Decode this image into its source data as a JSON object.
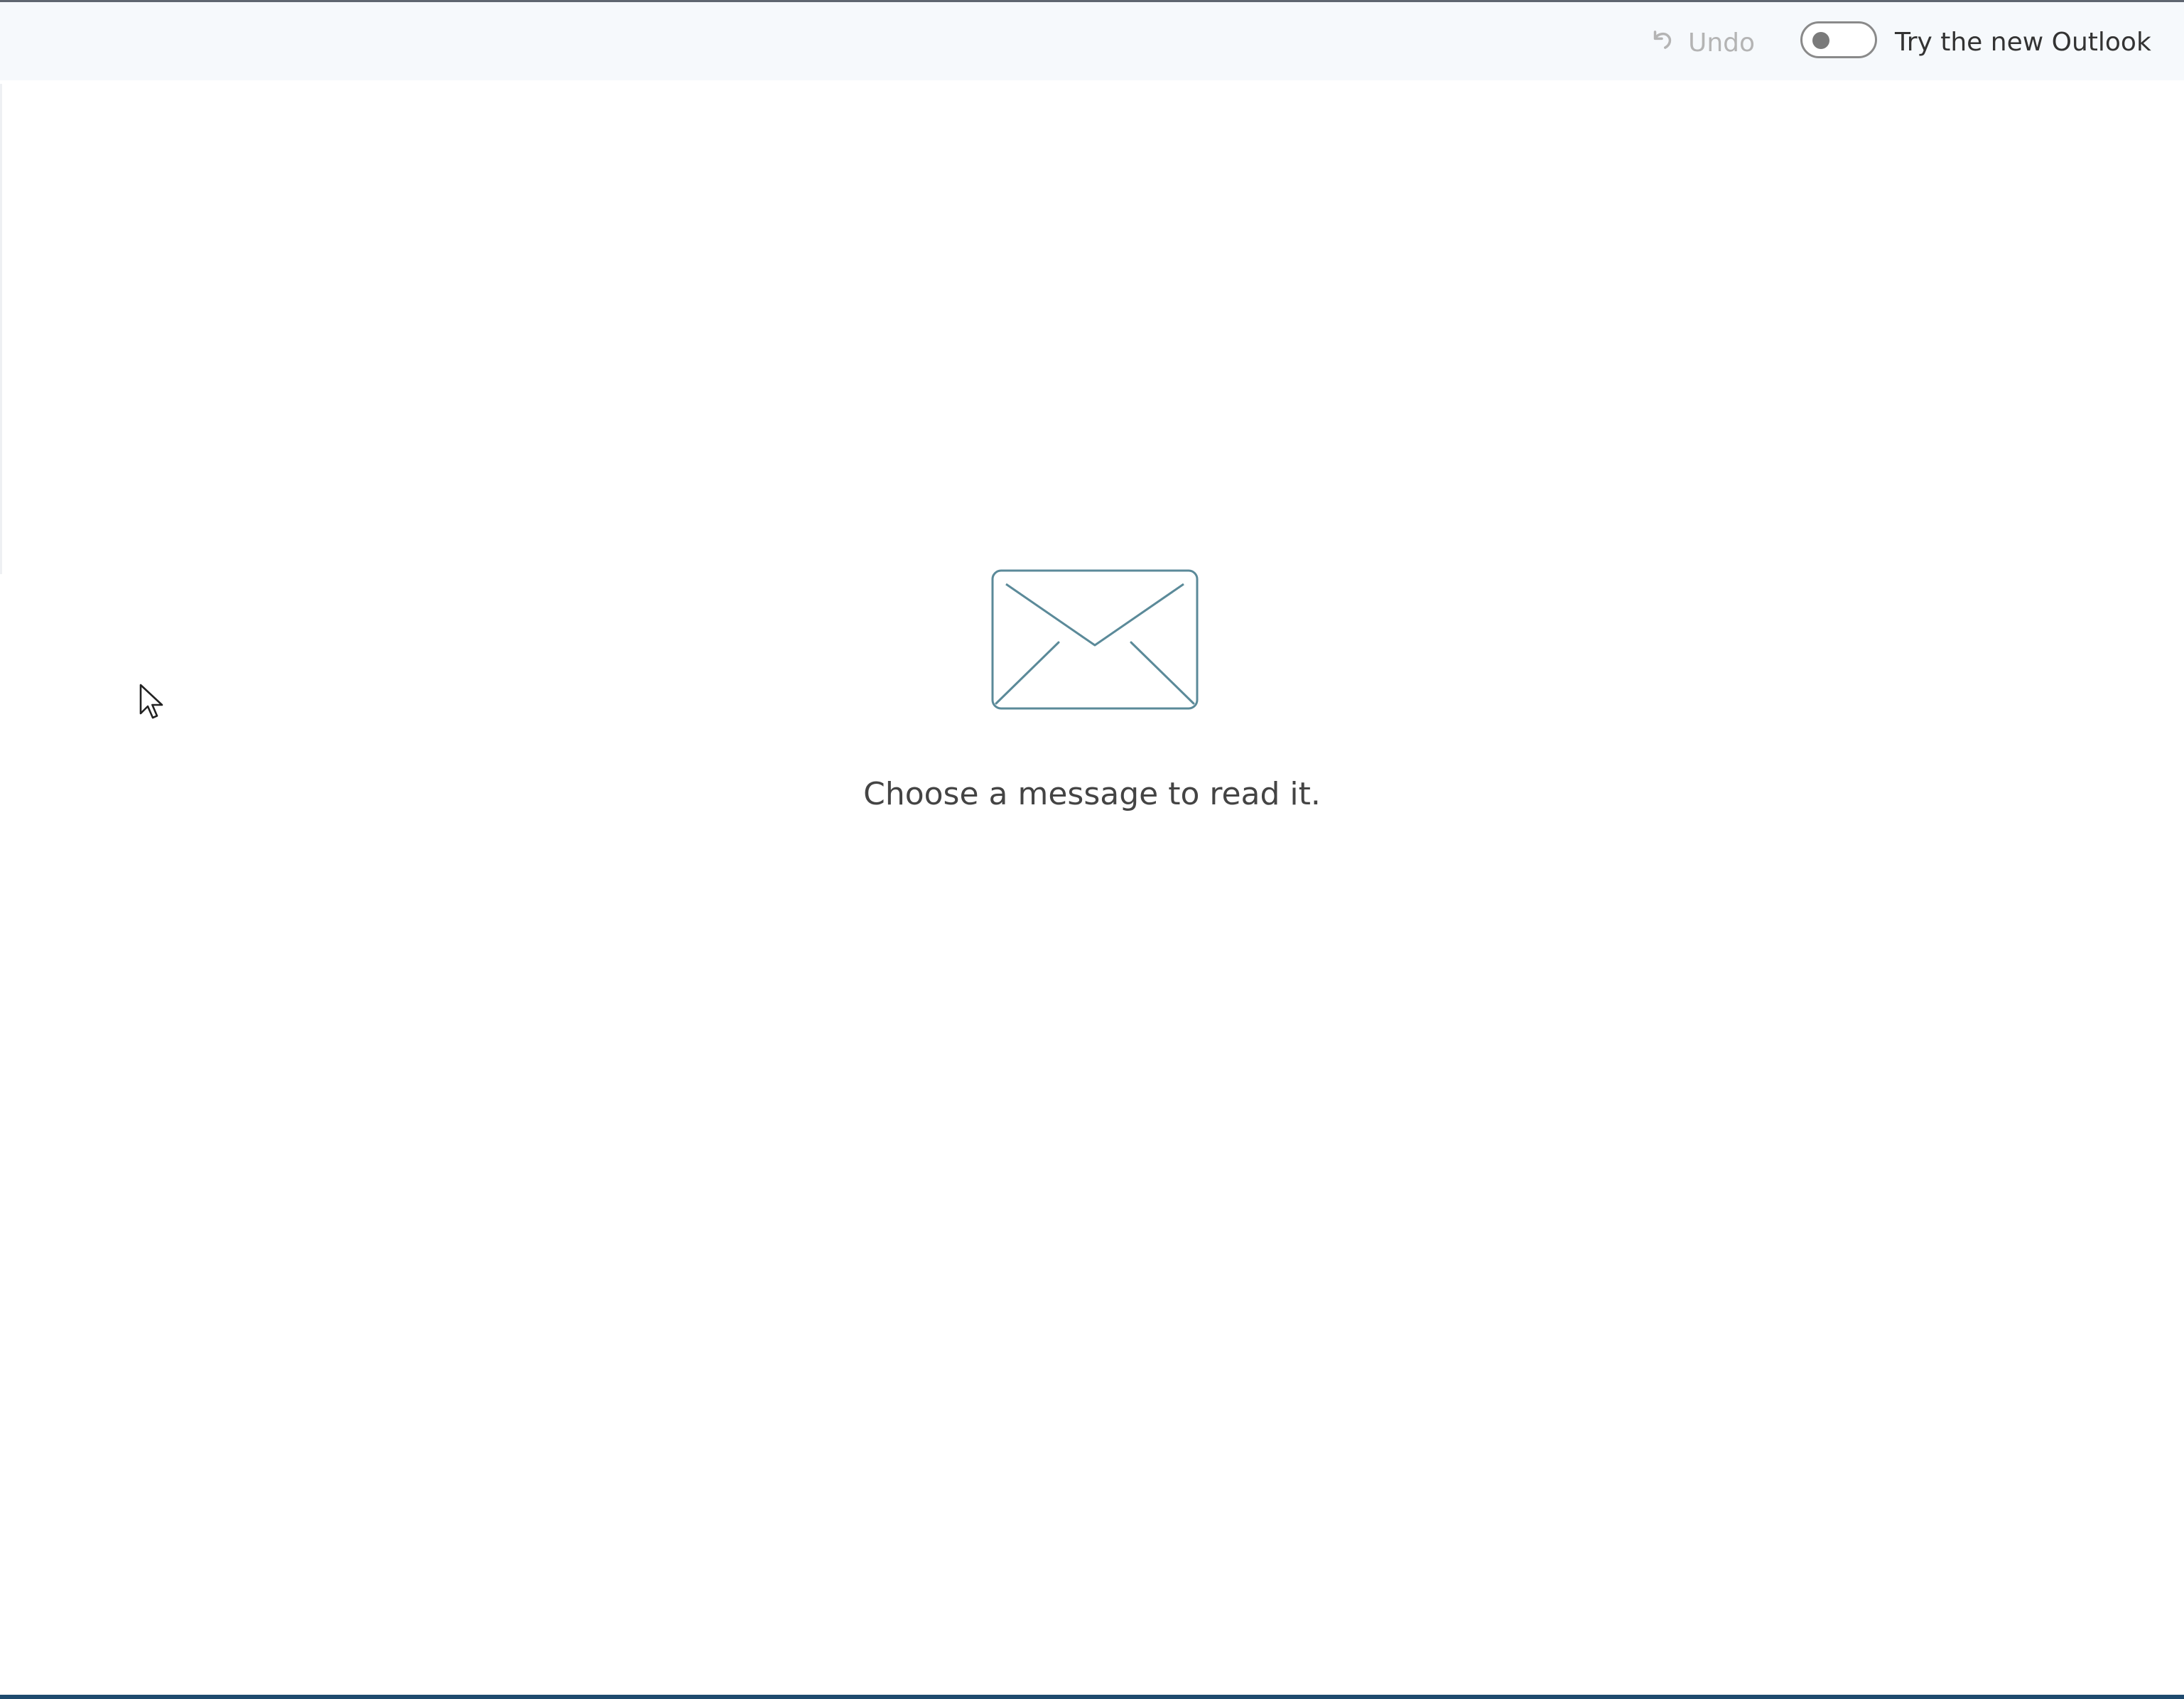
{
  "toolbar": {
    "undo_label": "Undo",
    "undo_icon": "undo-arrow-icon",
    "new_outlook_label": "Try the new Outlook",
    "new_outlook_toggle_on": false
  },
  "reading_pane": {
    "empty_icon": "envelope-icon",
    "empty_message": "Choose a message to read it."
  },
  "colors": {
    "toolbar_bg": "#f6f9fc",
    "envelope_stroke": "#5b8a99",
    "text": "#444444",
    "disabled_text": "#b4b4b4",
    "bottom_accent": "#1e4a6e"
  }
}
